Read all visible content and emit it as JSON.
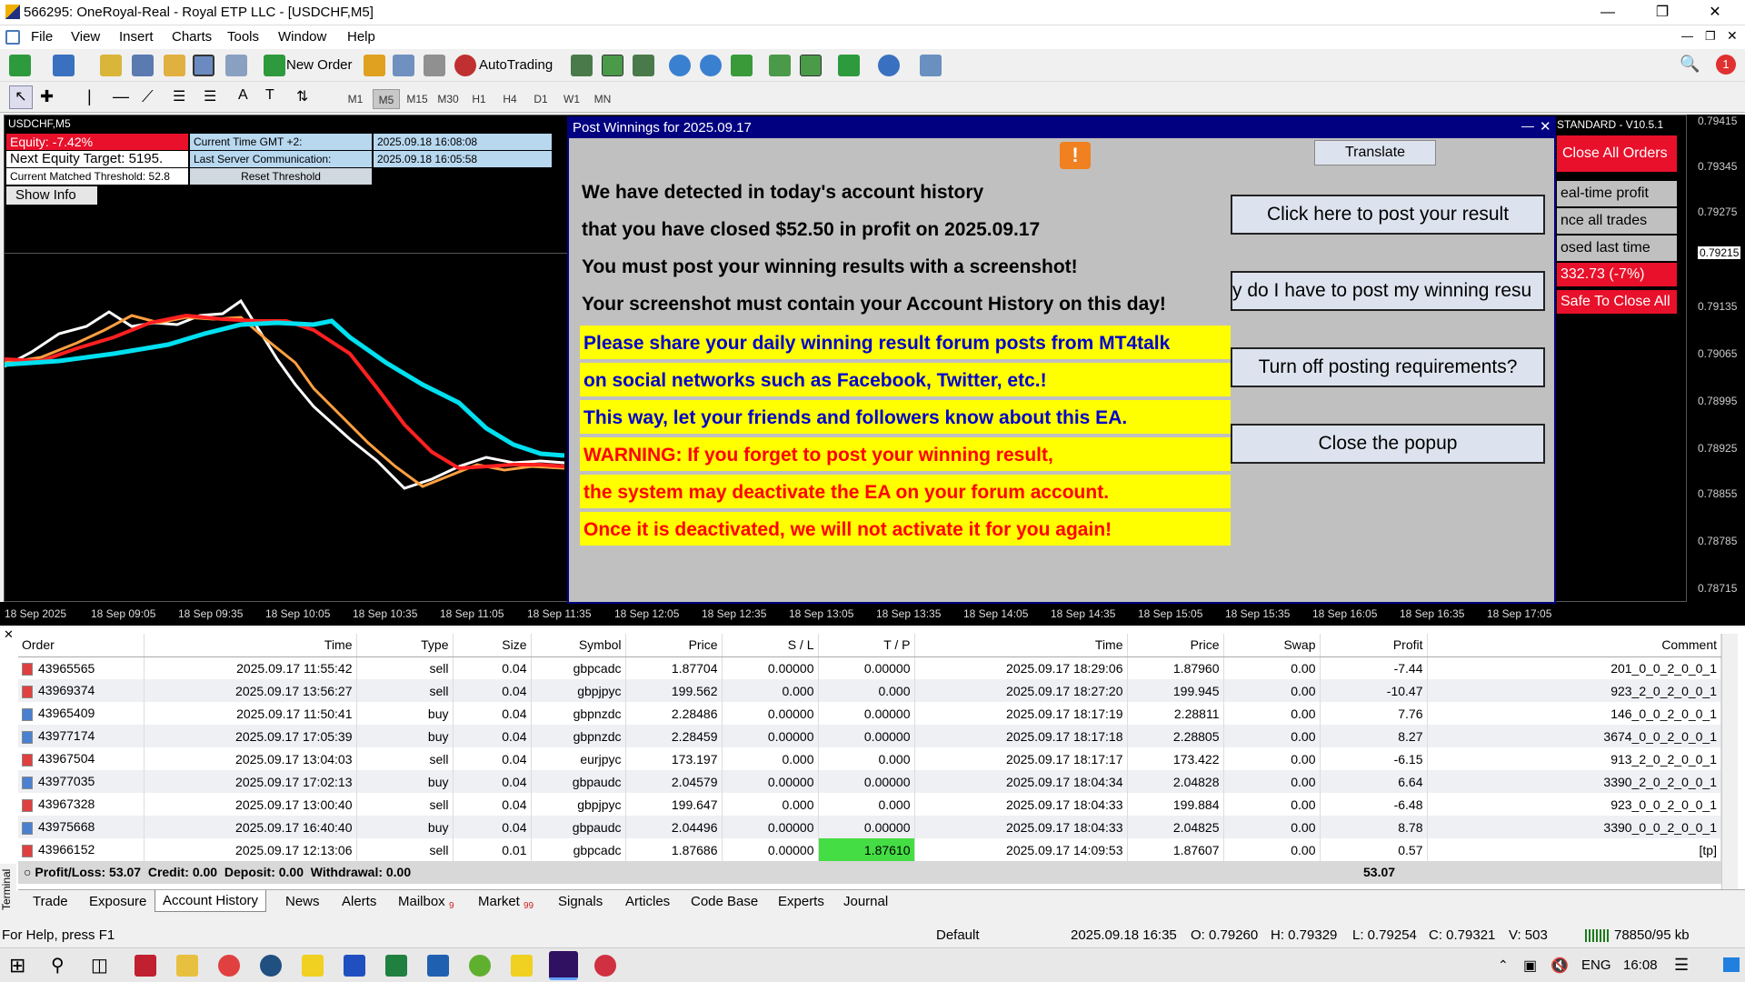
{
  "window": {
    "title": "566295: OneRoyal-Real - Royal ETP LLC - [USDCHF,M5]"
  },
  "menu": [
    "File",
    "View",
    "Insert",
    "Charts",
    "Tools",
    "Window",
    "Help"
  ],
  "toolbar": {
    "new_order": "New Order",
    "autotrading": "AutoTrading"
  },
  "timeframes": [
    "M1",
    "M5",
    "M15",
    "M30",
    "H1",
    "H4",
    "D1",
    "W1",
    "MN"
  ],
  "chart": {
    "symbol": "USDCHF,M5",
    "equity": "Equity: -7.42%",
    "next_target": "Next Equity Target: 5195.",
    "threshold": "Current Matched Threshold: 52.8",
    "show_info": "Show Info",
    "gmt_label": "Current Time GMT +2:",
    "gmt_value": "2025.09.18 16:08:08",
    "server_label": "Last Server Communication:",
    "server_value": "2025.09.18 16:05:58",
    "reset": "Reset Threshold",
    "ea_title": "STANDARD - V10.5.1",
    "close_all": "Close All Orders",
    "side1": "eal-time profit",
    "side2": "nce all trades",
    "side3": "osed last time",
    "side4": "332.73 (-7%)",
    "side5": "Safe To Close All",
    "prices": [
      "0.79415",
      "0.79345",
      "0.79275",
      "0.79215",
      "0.79135",
      "0.79065",
      "0.78995",
      "0.78925",
      "0.78855",
      "0.78785",
      "0.78715"
    ],
    "times": [
      "18 Sep 2025",
      "18 Sep 09:05",
      "18 Sep 09:35",
      "18 Sep 10:05",
      "18 Sep 10:35",
      "18 Sep 11:05",
      "18 Sep 11:35",
      "18 Sep 12:05",
      "18 Sep 12:35",
      "18 Sep 13:05",
      "18 Sep 13:35",
      "18 Sep 14:05",
      "18 Sep 14:35",
      "18 Sep 15:05",
      "18 Sep 15:35",
      "18 Sep 16:05",
      "18 Sep 16:35",
      "18 Sep 17:05"
    ]
  },
  "popup": {
    "title": "Post Winnings for 2025.09.17",
    "translate": "Translate",
    "lines": [
      "We have detected in today's account history",
      "that you have closed $52.50 in profit on 2025.09.17",
      "You must post your winning results with a screenshot!",
      "Your screenshot must contain your Account History on this day!"
    ],
    "blue_lines": [
      "Please share your daily winning result forum posts from MT4talk",
      "on social networks such as Facebook, Twitter, etc.!",
      "This way, let your friends and followers know about this EA."
    ],
    "red_lines": [
      "WARNING: If you forget to post your winning result,",
      "the system may deactivate the EA on your forum account.",
      "Once it is deactivated, we will not activate it for you again!"
    ],
    "btn_post": "Click here to post your result",
    "btn_why": "y do I have to post my winning resu",
    "btn_turnoff": "Turn off posting requirements?",
    "btn_close": "Close the popup"
  },
  "table": {
    "headers": [
      "Order",
      "Time",
      "Type",
      "Size",
      "Symbol",
      "Price",
      "S / L",
      "T / P",
      "Time",
      "Price",
      "Swap",
      "Profit",
      "Comment"
    ],
    "rows": [
      [
        "43965565",
        "2025.09.17 11:55:42",
        "sell",
        "0.04",
        "gbpcadc",
        "1.87704",
        "0.00000",
        "0.00000",
        "2025.09.17 18:29:06",
        "1.87960",
        "0.00",
        "-7.44",
        "201_0_0_2_0_0_1"
      ],
      [
        "43969374",
        "2025.09.17 13:56:27",
        "sell",
        "0.04",
        "gbpjpyc",
        "199.562",
        "0.000",
        "0.000",
        "2025.09.17 18:27:20",
        "199.945",
        "0.00",
        "-10.47",
        "923_2_0_2_0_0_1"
      ],
      [
        "43965409",
        "2025.09.17 11:50:41",
        "buy",
        "0.04",
        "gbpnzdc",
        "2.28486",
        "0.00000",
        "0.00000",
        "2025.09.17 18:17:19",
        "2.28811",
        "0.00",
        "7.76",
        "146_0_0_2_0_0_1"
      ],
      [
        "43977174",
        "2025.09.17 17:05:39",
        "buy",
        "0.04",
        "gbpnzdc",
        "2.28459",
        "0.00000",
        "0.00000",
        "2025.09.17 18:17:18",
        "2.28805",
        "0.00",
        "8.27",
        "3674_0_0_2_0_0_1"
      ],
      [
        "43967504",
        "2025.09.17 13:04:03",
        "sell",
        "0.04",
        "eurjpyc",
        "173.197",
        "0.000",
        "0.000",
        "2025.09.17 18:17:17",
        "173.422",
        "0.00",
        "-6.15",
        "913_2_0_2_0_0_1"
      ],
      [
        "43977035",
        "2025.09.17 17:02:13",
        "buy",
        "0.04",
        "gbpaudc",
        "2.04579",
        "0.00000",
        "0.00000",
        "2025.09.17 18:04:34",
        "2.04828",
        "0.00",
        "6.64",
        "3390_2_0_2_0_0_1"
      ],
      [
        "43967328",
        "2025.09.17 13:00:40",
        "sell",
        "0.04",
        "gbpjpyc",
        "199.647",
        "0.000",
        "0.000",
        "2025.09.17 18:04:33",
        "199.884",
        "0.00",
        "-6.48",
        "923_0_0_2_0_0_1"
      ],
      [
        "43975668",
        "2025.09.17 16:40:40",
        "buy",
        "0.04",
        "gbpaudc",
        "2.04496",
        "0.00000",
        "0.00000",
        "2025.09.17 18:04:33",
        "2.04825",
        "0.00",
        "8.78",
        "3390_0_0_2_0_0_1"
      ],
      [
        "43966152",
        "2025.09.17 12:13:06",
        "sell",
        "0.01",
        "gbpcadc",
        "1.87686",
        "0.00000",
        "1.87610",
        "2025.09.17 14:09:53",
        "1.87607",
        "0.00",
        "0.57",
        "[tp]"
      ]
    ],
    "summary": "Profit/Loss: 53.07  Credit: 0.00  Deposit: 0.00  Withdrawal: 0.00",
    "total": "53.07"
  },
  "tabs": [
    "Trade",
    "Exposure",
    "Account History",
    "News",
    "Alerts",
    "Mailbox",
    "Market",
    "Signals",
    "Articles",
    "Code Base",
    "Experts",
    "Journal"
  ],
  "tab_badges": {
    "mailbox": "9",
    "market": "99"
  },
  "terminal_label": "Terminal",
  "status": {
    "help": "For Help, press F1",
    "profile": "Default",
    "datetime": "2025.09.18 16:35",
    "open": "O: 0.79260",
    "high": "H: 0.79329",
    "low": "L: 0.79254",
    "close": "C: 0.79321",
    "volume": "V: 503",
    "traffic": "78850/95 kb"
  },
  "taskbar": {
    "lang": "ENG",
    "clock": "16:08"
  },
  "colors": {
    "popup_header": "#000080",
    "yellow": "#ffff00",
    "blue_text": "#0000cc",
    "red_text": "#ff0000",
    "equity_bg": "#e8102a",
    "tp_green": "#44dd44"
  }
}
